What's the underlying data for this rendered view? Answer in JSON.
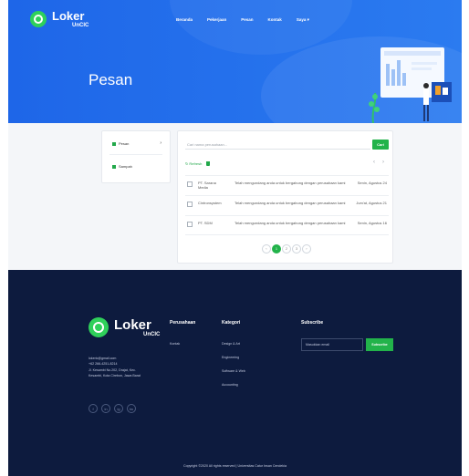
{
  "brand": {
    "name": "Loker",
    "sub": "UnCIC"
  },
  "nav": {
    "items": [
      "Beranda",
      "Pekerjaan",
      "Pesan",
      "Kontak",
      "Saya ▾"
    ]
  },
  "hero": {
    "title": "Pesan"
  },
  "sidebar": {
    "items": [
      {
        "label": "Pesan",
        "chevron": "›"
      },
      {
        "label": "Sampah"
      }
    ]
  },
  "messages": {
    "search_placeholder": "Cari nama perusahaan...",
    "search_button": "Cari",
    "refresh_label": "Refresh",
    "prev_arrow": "‹",
    "next_arrow": "›",
    "rows": [
      {
        "sender": "PT. Sarana Media",
        "subject": "Telah mengundang anda untuk bergabung dengan perusahaan kami",
        "date": "Senin, Agustus 24"
      },
      {
        "sender": "Cintronsystem",
        "subject": "Telah mengundang anda untuk bergabung dengan perusahaan kami",
        "date": "Jum'at, Agustus 21"
      },
      {
        "sender": "PT. SDM",
        "subject": "Telah mengundang anda untuk bergabung dengan perusahaan kami",
        "date": "Senin, Agustus 16"
      }
    ],
    "pagination": [
      "‹",
      "1",
      "2",
      "3",
      "›"
    ],
    "active_page": "1"
  },
  "footer": {
    "contact": [
      "lokeric@gmail.com",
      "+62 266-4251-8214",
      "Jl. Kesambi No.202, Drajat, Kec.",
      "Kesambi, Kota Cirebon, Jawa Barat"
    ],
    "socials": [
      "f",
      "in",
      "ig",
      "tw"
    ],
    "perusahaan": {
      "title": "Perusahaan",
      "links": [
        "Kontak"
      ]
    },
    "kategori": {
      "title": "Kategori",
      "links": [
        "Design & Art",
        "Engineering",
        "Software & Web",
        "Accounting"
      ]
    },
    "subscribe": {
      "title": "Subscribe",
      "placeholder": "Masukkan email",
      "button": "Subscribe"
    },
    "copyright": "Copyright ©2020 All rights reserved | Universitas Catur Insan Cendekia"
  },
  "colors": {
    "primary_blue": "#2b7bf0",
    "accent_green": "#22b34a",
    "footer_navy": "#0d1b3e"
  }
}
